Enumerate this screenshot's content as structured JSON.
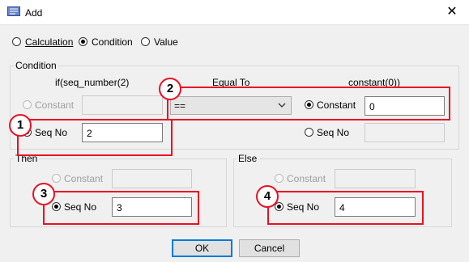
{
  "window": {
    "title": "Add",
    "close_glyph": "✕"
  },
  "mode": {
    "options": [
      "Calculation",
      "Condition",
      "Value"
    ],
    "selected": "Condition"
  },
  "condition": {
    "group_label": "Condition",
    "left_header": "if(seq_number(2)",
    "operator_header": "Equal To",
    "right_header": "constant(0))",
    "left": {
      "constant_label": "Constant",
      "constant_value": "",
      "seqno_label": "Seq No",
      "seqno_value": "2",
      "selected": "Seq No"
    },
    "operator": {
      "value": "=="
    },
    "right": {
      "constant_label": "Constant",
      "constant_value": "0",
      "seqno_label": "Seq No",
      "seqno_value": "",
      "selected": "Constant"
    }
  },
  "then": {
    "group_label": "Then",
    "constant_label": "Constant",
    "constant_value": "",
    "seqno_label": "Seq No",
    "seqno_value": "3",
    "selected": "Seq No"
  },
  "else": {
    "group_label": "Else",
    "constant_label": "Constant",
    "constant_value": "",
    "seqno_label": "Seq No",
    "seqno_value": "4",
    "selected": "Seq No"
  },
  "buttons": {
    "ok": "OK",
    "cancel": "Cancel"
  },
  "callouts": [
    "1",
    "2",
    "3",
    "4"
  ],
  "colors": {
    "highlight": "#e81123",
    "focus": "#0078d7"
  }
}
